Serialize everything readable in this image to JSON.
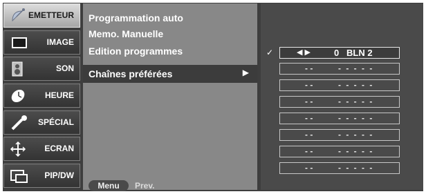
{
  "sidebar": {
    "items": [
      {
        "label": "EMETTEUR",
        "icon": "satellite-dish-icon",
        "active": true
      },
      {
        "label": "IMAGE",
        "icon": "monitor-icon",
        "active": false
      },
      {
        "label": "SON",
        "icon": "speaker-icon",
        "active": false
      },
      {
        "label": "HEURE",
        "icon": "clock-icon",
        "active": false
      },
      {
        "label": "SPÉCIAL",
        "icon": "wrench-icon",
        "active": false
      },
      {
        "label": "ECRAN",
        "icon": "screen-adjust-icon",
        "active": false
      },
      {
        "label": "PIP/DW",
        "icon": "pip-icon",
        "active": false
      }
    ]
  },
  "menu": {
    "items": [
      {
        "label": "Programmation auto"
      },
      {
        "label": "Memo. Manuelle"
      },
      {
        "label": "Edition programmes"
      }
    ],
    "selected": {
      "label": "Chaînes préférées",
      "arrow": "▶"
    },
    "footer": {
      "menu_button": "Menu",
      "prev_label": "Prev."
    }
  },
  "favorites": {
    "check": "✓",
    "selected_row": {
      "arrows": "◀ ▶",
      "number": "0",
      "name": "BLN 2"
    },
    "empty_rows": [
      {
        "number": "- -",
        "name": "- - - - -"
      },
      {
        "number": "- -",
        "name": "- - - - -"
      },
      {
        "number": "- -",
        "name": "- - - - -"
      },
      {
        "number": "- -",
        "name": "- - - - -"
      },
      {
        "number": "- -",
        "name": "- - - - -"
      },
      {
        "number": "- -",
        "name": "- - - - -"
      },
      {
        "number": "- -",
        "name": "- - - - -"
      }
    ]
  },
  "colors": {
    "background": "#3e3e3e",
    "menu_panel": "#888888",
    "accent_active": "#c0c0c0"
  }
}
